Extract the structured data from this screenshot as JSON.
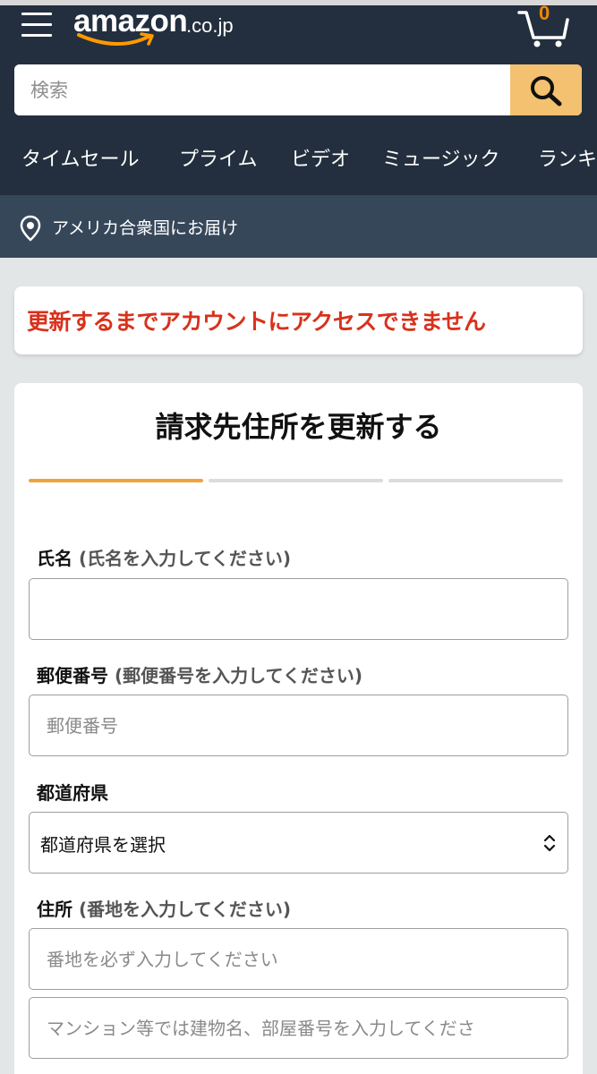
{
  "header": {
    "logo_word": "amazon",
    "logo_tld": ".co.jp",
    "cart_count": "0",
    "search_placeholder": "検索",
    "nav_items": [
      "タイムセール",
      "プライム",
      "ビデオ",
      "ミュージック",
      "ランキ"
    ],
    "delivery": "アメリカ合衆国にお届け"
  },
  "alert": {
    "text": "更新するまでアカウントにアクセスできません"
  },
  "form": {
    "title": "請求先住所を更新する",
    "name_label": "氏名",
    "name_hint": "(氏名を入力してください)",
    "name_placeholder": "",
    "postal_label": "郵便番号",
    "postal_hint": "(郵便番号を入力してください)",
    "postal_placeholder": "郵便番号",
    "prefecture_label": "都道府県",
    "prefecture_value": "都道府県を選択",
    "address_label": "住所",
    "address_hint": "(番地を入力してください)",
    "address1_placeholder": "番地を必ず入力してください",
    "address2_placeholder": "マンション等では建物名、部屋番号を入力してくださ"
  },
  "colors": {
    "header_bg": "#232f3e",
    "delivery_bg": "#37475a",
    "search_button": "#f3c16f",
    "alert_text": "#d8311c",
    "step_active": "#f0a33c",
    "cart_count": "#f08804"
  },
  "icons": [
    "menu-icon",
    "cart-icon",
    "search-icon",
    "location-pin-icon",
    "select-arrows-icon"
  ]
}
